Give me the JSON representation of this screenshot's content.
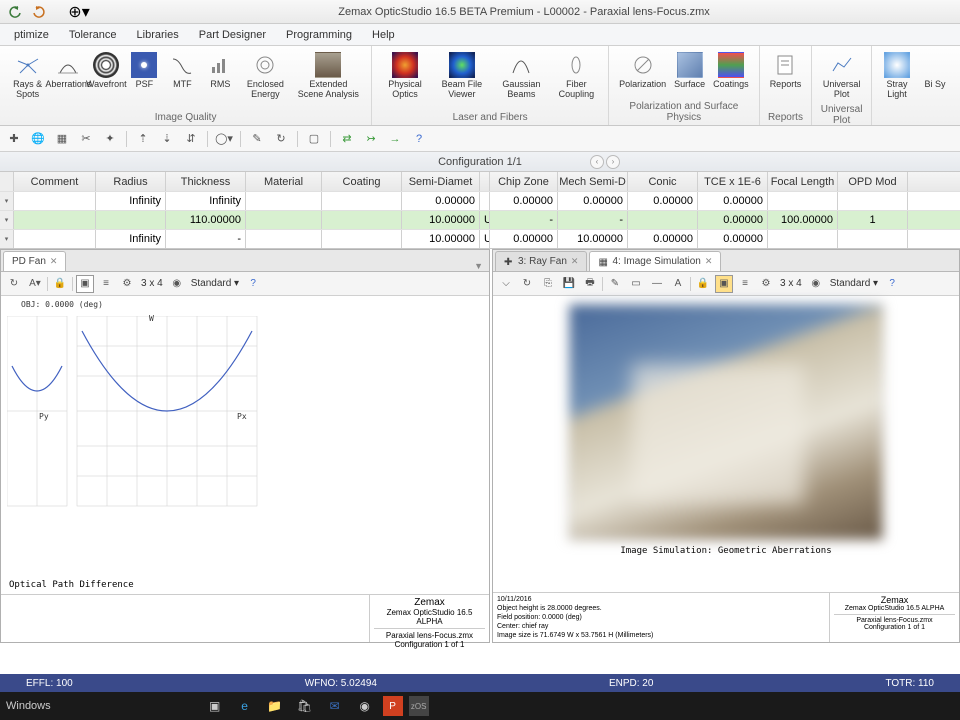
{
  "title": "Zemax OpticStudio 16.5  BETA  Premium - L00002 - Paraxial lens-Focus.zmx",
  "menu": [
    "ptimize",
    "Tolerance",
    "Libraries",
    "Part Designer",
    "Programming",
    "Help"
  ],
  "ribbon": {
    "groups": [
      {
        "label": "Image Quality",
        "items": [
          "Rays & Spots",
          "Aberrations",
          "Wavefront",
          "PSF",
          "MTF",
          "RMS",
          "Enclosed Energy",
          "Extended Scene Analysis"
        ]
      },
      {
        "label": "Laser and Fibers",
        "items": [
          "Physical Optics",
          "Beam File Viewer",
          "Gaussian Beams",
          "Fiber Coupling"
        ]
      },
      {
        "label": "Polarization and Surface Physics",
        "items": [
          "Polarization",
          "Surface",
          "Coatings"
        ]
      },
      {
        "label": "Reports",
        "items": [
          "Reports"
        ]
      },
      {
        "label": "Universal Plot",
        "items": [
          "Universal Plot"
        ]
      },
      {
        "label": "",
        "items": [
          "Stray Light",
          "Bi Sy"
        ]
      }
    ]
  },
  "config_label": "Configuration 1/1",
  "table": {
    "headers": [
      "Comment",
      "Radius",
      "Thickness",
      "Material",
      "Coating",
      "Semi-Diamet",
      "Chip Zone",
      "Mech Semi-D",
      "Conic",
      "TCE x 1E-6",
      "Focal Length",
      "OPD Mod"
    ],
    "rows": [
      {
        "hl": false,
        "u": "",
        "cells": [
          "",
          "Infinity",
          "Infinity",
          "",
          "",
          "0.00000",
          "0.00000",
          "0.00000",
          "0.00000",
          "0.00000",
          "",
          ""
        ]
      },
      {
        "hl": true,
        "u": "U",
        "cells": [
          "",
          "",
          "110.00000",
          "",
          "",
          "10.00000",
          "-",
          "-",
          "",
          "0.00000",
          "100.00000",
          "1"
        ]
      },
      {
        "hl": false,
        "u": "U",
        "cells": [
          "",
          "Infinity",
          "-",
          "",
          "",
          "10.00000",
          "0.00000",
          "10.00000",
          "0.00000",
          "0.00000",
          "",
          ""
        ]
      }
    ]
  },
  "left_panel": {
    "tab": "PD Fan",
    "layout": "3 x 4",
    "mode": "Standard",
    "obj_label": "OBJ:  0.0000 (deg)",
    "y_label": "W",
    "px": "Px",
    "py": "Py",
    "plot_title": "Optical Path Difference",
    "footer_right_title": "Zemax",
    "footer_right_sub": "Zemax OpticStudio 16.5  ALPHA",
    "footer_right_file": "Paraxial lens-Focus.zmx",
    "footer_right_cfg": "Configuration 1 of 1"
  },
  "right_panel": {
    "tabs": [
      {
        "label": "3: Ray Fan"
      },
      {
        "label": "4: Image Simulation"
      }
    ],
    "layout": "3 x 4",
    "mode": "Standard",
    "sim_title": "Image Simulation: Geometric Aberrations",
    "footer_left": [
      "10/11/2016",
      "Object height is 28.0000 degrees.",
      "Field position:   0.0000 (deg)",
      "Center: chief ray",
      "Image size is 71.6749 W x 53.7561 H (Millimeters)"
    ],
    "footer_right_title": "Zemax",
    "footer_right_sub": "Zemax OpticStudio 16.5  ALPHA",
    "footer_right_file": "Paraxial lens-Focus.zmx",
    "footer_right_cfg": "Configuration 1 of 1"
  },
  "status": {
    "effl": "EFFL: 100",
    "wfno": "WFNO: 5.02494",
    "enpd": "ENPD: 20",
    "totr": "TOTR: 110"
  },
  "taskbar": {
    "os": "Windows"
  }
}
